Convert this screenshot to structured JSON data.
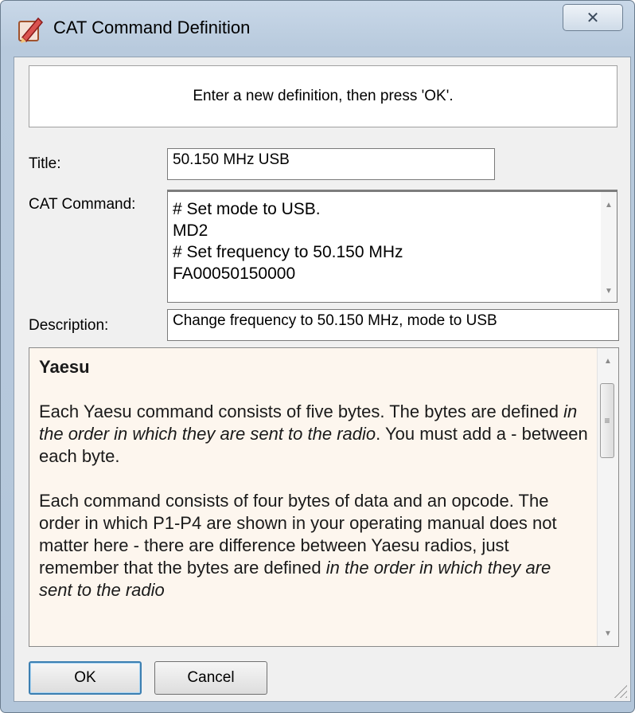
{
  "window": {
    "title": "CAT Command Definition",
    "close_label": "✕"
  },
  "banner": {
    "text": "Enter a new definition, then press 'OK'."
  },
  "form": {
    "title_label": "Title:",
    "title_value": "50.150 MHz USB",
    "cat_label": "CAT Command:",
    "cat_lines": [
      "# Set mode to USB.",
      "MD2",
      "# Set frequency to 50.150 MHz",
      "FA00050150000"
    ],
    "description_label": "Description:",
    "description_value": "Change frequency to 50.150 MHz, mode to USB"
  },
  "help": {
    "heading": "Yaesu",
    "para1_part1": "Each Yaesu command consists of five bytes. The bytes are defined ",
    "para1_italic": "in the order in which they are sent to the radio",
    "para1_part2": ". You must add a - between each byte.",
    "para2_part1": "Each command consists of four bytes of data and an opcode. The order in which P1-P4 are shown in your operating manual does not matter here - there are difference between Yaesu radios, just remember that the bytes are defined ",
    "para2_italic": "in the order in which they are sent to the radio"
  },
  "buttons": {
    "ok": "OK",
    "cancel": "Cancel"
  },
  "colors": {
    "help_background": "#fdf6ee",
    "titlebar": "#c3d3e4"
  }
}
